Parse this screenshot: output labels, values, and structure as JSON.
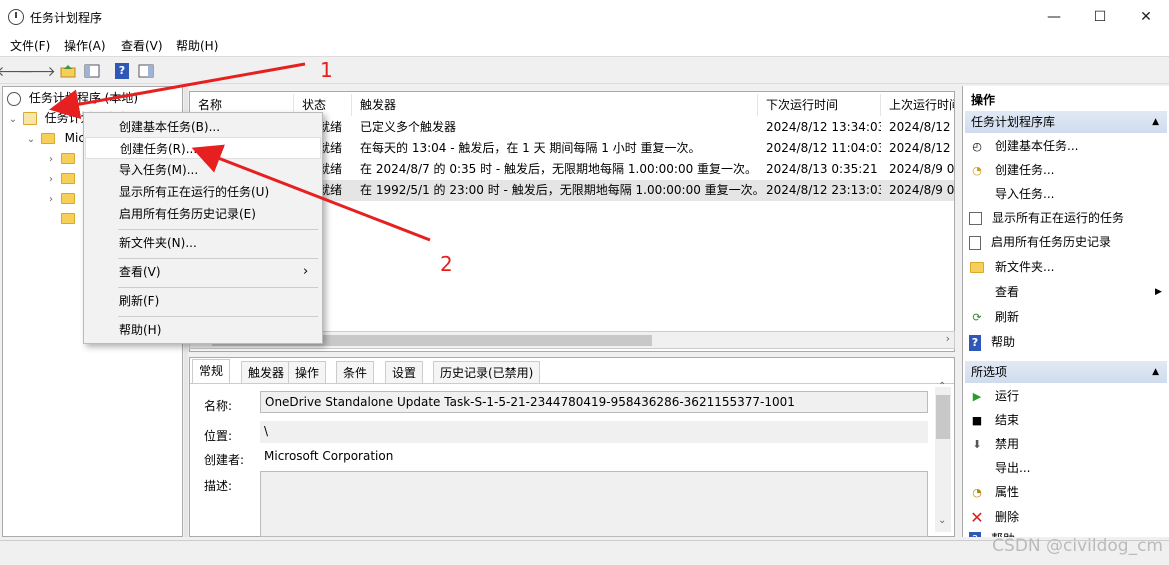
{
  "window": {
    "title": "任务计划程序",
    "min_glyph": "—",
    "max_glyph": "☐",
    "close_glyph": "✕"
  },
  "menu": [
    "文件(F)",
    "操作(A)",
    "查看(V)",
    "帮助(H)"
  ],
  "toolbar": {
    "back_glyph": "🡐",
    "fwd_glyph": "🡒",
    "help_glyph": "?"
  },
  "tree": {
    "root": "任务计划程序 (本地)",
    "library": "任务计划程序库",
    "microsoft": "Mic"
  },
  "task_list": {
    "headers": [
      "名称",
      "状态",
      "触发器",
      "下次运行时间",
      "上次运行时间"
    ],
    "rows": [
      {
        "status": "就绪",
        "trigger": "已定义多个触发器",
        "next": "2024/8/12 13:34:03",
        "last": "2024/8/12 1"
      },
      {
        "status": "就绪",
        "trigger": "在每天的 13:04 - 触发后，在 1 天 期间每隔 1 小时 重复一次。",
        "next": "2024/8/12 11:04:03",
        "last": "2024/8/12 1"
      },
      {
        "status": "就绪",
        "trigger": "在 2024/8/7 的 0:35 时 - 触发后，无限期地每隔 1.00:00:00 重复一次。",
        "next": "2024/8/13 0:35:21",
        "last": "2024/8/9 0:"
      },
      {
        "status": "就绪",
        "trigger": "在 1992/5/1 的 23:00 时 - 触发后，无限期地每隔 1.00:00:00 重复一次。",
        "next": "2024/8/12 23:13:03",
        "last": "2024/8/9 0:"
      }
    ]
  },
  "detail": {
    "tabs": [
      "常规",
      "触发器",
      "操作",
      "条件",
      "设置",
      "历史记录(已禁用)"
    ],
    "name_label": "名称:",
    "name_value": "OneDrive Standalone Update Task-S-1-5-21-2344780419-958436286-3621155377-1001",
    "location_label": "位置:",
    "location_value": "\\",
    "author_label": "创建者:",
    "author_value": "Microsoft Corporation",
    "desc_label": "描述:"
  },
  "context_menu": {
    "items": [
      "创建基本任务(B)...",
      "创建任务(R)...",
      "导入任务(M)...",
      "显示所有正在运行的任务(U)",
      "启用所有任务历史记录(E)",
      "新文件夹(N)...",
      "查看(V)",
      "刷新(F)",
      "帮助(H)"
    ],
    "submenu_arrow": "›"
  },
  "actions_pane": {
    "header": "操作",
    "section1": "任务计划程序库",
    "items1": [
      "创建基本任务...",
      "创建任务...",
      "导入任务...",
      "显示所有正在运行的任务",
      "启用所有任务历史记录",
      "新文件夹...",
      "查看",
      "刷新",
      "帮助"
    ],
    "section2": "所选项",
    "items2": [
      "运行",
      "结束",
      "禁用",
      "导出...",
      "属性",
      "删除",
      "帮助"
    ]
  },
  "annotations": {
    "a1": "1",
    "a2": "2"
  },
  "watermark": "CSDN @civildog_cm",
  "colors": {
    "annotation": "#e62020",
    "section_header": "#cfdcee",
    "folder": "#f5cf57"
  }
}
